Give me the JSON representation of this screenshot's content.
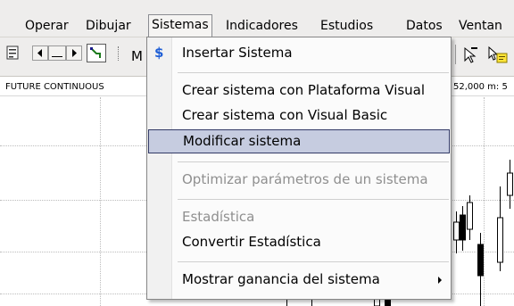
{
  "menubar": {
    "items": [
      {
        "label": "Operar"
      },
      {
        "label": "Dibujar"
      },
      {
        "label": "Sistemas"
      },
      {
        "label": "Indicadores"
      },
      {
        "label": "Estudios"
      },
      {
        "label": "Datos"
      },
      {
        "label": "Ventan"
      }
    ]
  },
  "toolbar": {
    "combo_text": "M"
  },
  "chart": {
    "header_left": "FUTURE CONTINUOUS",
    "header_right": "52,000  m: 5"
  },
  "sistemas_menu": {
    "items": [
      {
        "label": "Insertar Sistema",
        "icon": "dollar-icon",
        "enabled": true
      },
      {
        "label": "Crear sistema con Plataforma Visual",
        "enabled": true
      },
      {
        "label": "Crear sistema con Visual Basic",
        "enabled": true
      },
      {
        "label": "Modificar sistema",
        "enabled": true,
        "highlighted": true
      },
      {
        "label": "Optimizar parámetros de un sistema",
        "enabled": false
      },
      {
        "label": "Estadística",
        "enabled": false
      },
      {
        "label": "Convertir Estadística",
        "enabled": true
      },
      {
        "label": "Mostrar ganancia del sistema",
        "enabled": true,
        "has_submenu": true
      }
    ]
  },
  "colors": {
    "highlight_fill": "#c6cce0",
    "highlight_border": "#323a66",
    "dollar_icon": "#1f5fd6",
    "candle": "#000000"
  }
}
